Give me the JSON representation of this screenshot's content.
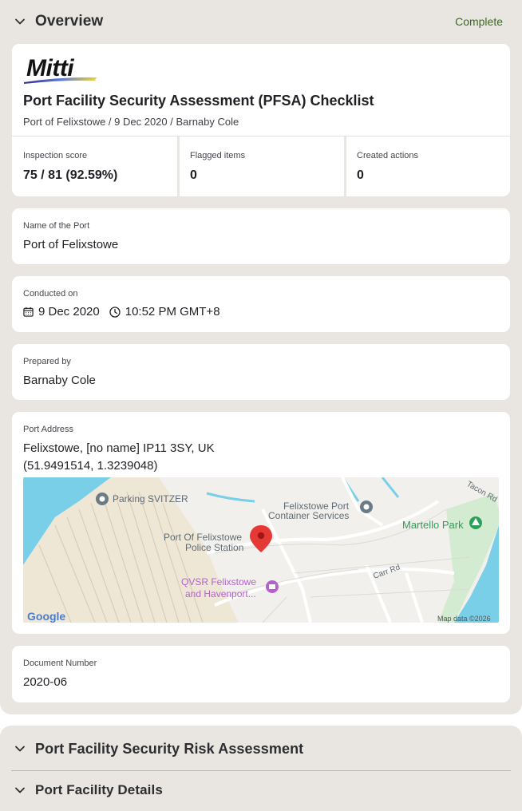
{
  "overview": {
    "title": "Overview",
    "status": "Complete",
    "status_color": "#3b6a1f"
  },
  "header_card": {
    "logo_text": "Mitti",
    "title": "Port Facility Security Assessment (PFSA) Checklist",
    "subtitle": "Port of Felixstowe / 9 Dec 2020 / Barnaby Cole",
    "stats": [
      {
        "label": "Inspection score",
        "value": "75 / 81 (92.59%)"
      },
      {
        "label": "Flagged items",
        "value": "0"
      },
      {
        "label": "Created actions",
        "value": "0"
      }
    ]
  },
  "port_name": {
    "label": "Name of the Port",
    "value": "Port of Felixstowe"
  },
  "conducted": {
    "label": "Conducted on",
    "date": "9 Dec 2020",
    "time": "10:52 PM GMT+8"
  },
  "prepared": {
    "label": "Prepared by",
    "value": "Barnaby Cole"
  },
  "address": {
    "label": "Port Address",
    "line1": "Felixstowe, [no name] IP11 3SY, UK",
    "line2": "(51.9491514, 1.3239048)",
    "map": {
      "places": {
        "parking": "Parking SVITZER",
        "container_1": "Felixstowe Port",
        "container_2": "Container Services",
        "police_1": "Port Of Felixstowe",
        "police_2": "Police Station",
        "martello": "Martello Park",
        "qvsr_1": "QVSR Felixstowe",
        "qvsr_2": "and Havenport...",
        "carr_rd": "Carr Rd",
        "tacon_rd": "Tacon Rd"
      },
      "google": "Google",
      "attribution": "Map data ©2026"
    }
  },
  "document": {
    "label": "Document Number",
    "value": "2020-06"
  },
  "sections": [
    {
      "title": "Port Facility Security Risk Assessment"
    },
    {
      "title": "Port Facility Details"
    }
  ]
}
